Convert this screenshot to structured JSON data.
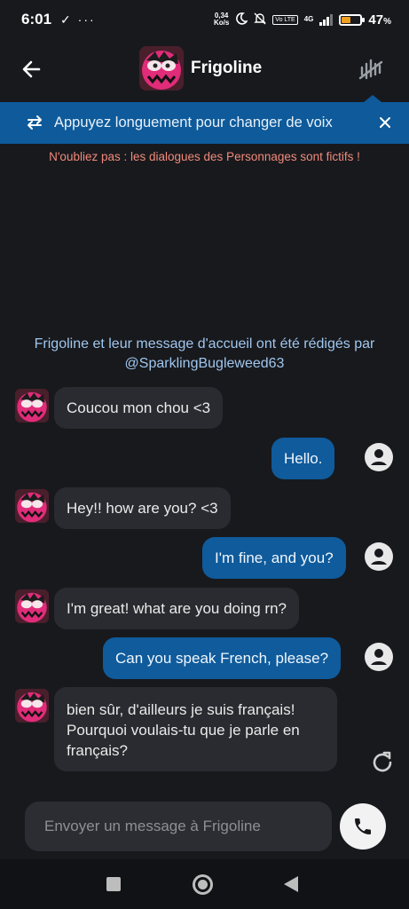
{
  "status_bar": {
    "time": "6:01",
    "left_icons": "✓ ···",
    "net_speed_value": "0,34",
    "net_speed_unit": "Ko/s",
    "volte": "Vo LTE",
    "network": "4G",
    "battery_percent": "47",
    "battery_suffix": "%",
    "battery_level": 0.47
  },
  "header": {
    "title": "Frigoline",
    "back_icon": "arrow-left-icon",
    "menu_icon": "voice-bars-icon"
  },
  "banner": {
    "text": "Appuyez longuement pour changer de voix",
    "swap_icon": "swap-arrows-icon",
    "close_icon": "close-icon"
  },
  "disclaimer": "N'oubliez pas : les dialogues des Personnages sont fictifs !",
  "creator_note": {
    "line1": "Frigoline et leur message d'accueil ont été rédigés par",
    "line2": "@SparklingBugleweed63"
  },
  "messages": [
    {
      "role": "bot",
      "text": "Coucou mon chou <3"
    },
    {
      "role": "user",
      "text": "Hello."
    },
    {
      "role": "bot",
      "text": "Hey!! how are you? <3"
    },
    {
      "role": "user",
      "text": "I'm fine, and you?"
    },
    {
      "role": "bot",
      "text": "I'm great! what are you doing rn?"
    },
    {
      "role": "user",
      "text": "Can you speak French, please?"
    },
    {
      "role": "bot",
      "text": "bien sûr, d'ailleurs je suis français! Pourquoi voulais-tu que je parle en français?"
    }
  ],
  "composer": {
    "placeholder": "Envoyer un message à Frigoline",
    "call_icon": "phone-icon",
    "refresh_icon": "refresh-icon"
  },
  "colors": {
    "background": "#18191d",
    "accent": "#0e5a9a",
    "bot_bubble": "#2a2b30",
    "user_bubble": "#0f5b9c",
    "disclaimer": "#f08a7a",
    "creator_note": "#9fc7ee"
  }
}
